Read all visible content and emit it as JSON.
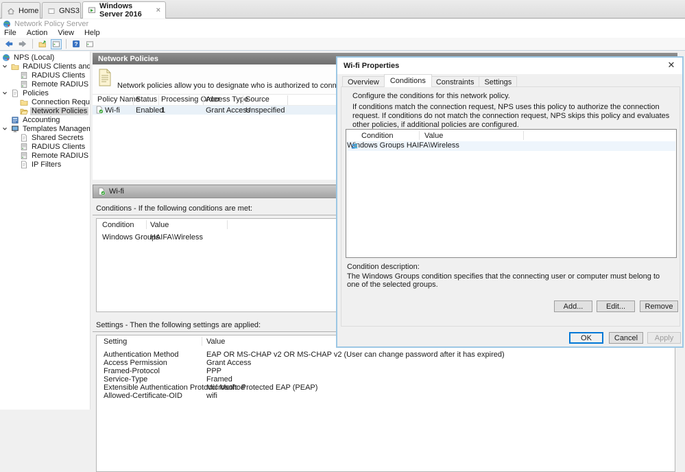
{
  "colors": {
    "accent": "#0078d7",
    "dialog_border": "#9cc7e4",
    "panel_header": "#6e6e6e",
    "selection_bg": "#d4d4d4",
    "row_highlight": "#e9f1f8"
  },
  "browser_tabs": [
    {
      "label": "Home"
    },
    {
      "label": "GNS3"
    },
    {
      "label": "Windows Server 2016"
    }
  ],
  "app": {
    "title": "Network Policy Server"
  },
  "menu": {
    "file": "File",
    "action": "Action",
    "view": "View",
    "help": "Help"
  },
  "tree": {
    "items": [
      {
        "label": "NPS (Local)"
      },
      {
        "label": "RADIUS Clients and Servers"
      },
      {
        "label": "RADIUS Clients"
      },
      {
        "label": "Remote RADIUS Server"
      },
      {
        "label": "Policies"
      },
      {
        "label": "Connection Request Po"
      },
      {
        "label": "Network Policies"
      },
      {
        "label": "Accounting"
      },
      {
        "label": "Templates Management"
      },
      {
        "label": "Shared Secrets"
      },
      {
        "label": "RADIUS Clients"
      },
      {
        "label": "Remote RADIUS Servers"
      },
      {
        "label": "IP Filters"
      }
    ]
  },
  "main": {
    "header": "Network Policies",
    "description": "Network policies allow you to designate who is authorized to connect to the network and the circ",
    "policy_table": {
      "columns": [
        "Policy Name",
        "Status",
        "Processing Order",
        "Access Type",
        "Source"
      ],
      "rows": [
        {
          "name": "Wi-fi",
          "status": "Enabled",
          "order": "1",
          "access": "Grant Access",
          "source": "Unspecified"
        }
      ]
    },
    "policy_section": {
      "title": "Wi-fi"
    },
    "conditions_header": "Conditions - If the following conditions are met:",
    "conditions_table": {
      "columns": [
        "Condition",
        "Value"
      ],
      "rows": [
        {
          "condition": "Windows Groups",
          "value": "HAIFA\\Wireless"
        }
      ]
    },
    "settings_header": "Settings - Then the following settings are applied:",
    "settings_table": {
      "columns": [
        "Setting",
        "Value"
      ],
      "rows": [
        {
          "setting": "Authentication Method",
          "value": "EAP OR MS-CHAP v2 OR MS-CHAP v2 (User can change password after it has expired)"
        },
        {
          "setting": "Access Permission",
          "value": "Grant Access"
        },
        {
          "setting": "Framed-Protocol",
          "value": "PPP"
        },
        {
          "setting": "Service-Type",
          "value": "Framed"
        },
        {
          "setting": "Extensible Authentication Protocol Method",
          "value": "Microsoft: Protected EAP (PEAP)"
        },
        {
          "setting": "Allowed-Certificate-OID",
          "value": "wifi"
        }
      ]
    }
  },
  "dialog": {
    "title": "Wi-fi Properties",
    "tabs": [
      {
        "label": "Overview"
      },
      {
        "label": "Conditions"
      },
      {
        "label": "Constraints"
      },
      {
        "label": "Settings"
      }
    ],
    "intro": "Configure the conditions for this network policy.",
    "body": "If conditions match the connection request, NPS uses this policy to authorize the connection request. If conditions do not match the connection request, NPS skips this policy and evaluates other policies, if additional policies are configured.",
    "table": {
      "columns": [
        "Condition",
        "Value"
      ],
      "rows": [
        {
          "condition": "Windows Groups",
          "value": "HAIFA\\Wireless"
        }
      ]
    },
    "description_label": "Condition description:",
    "description": "The Windows Groups condition specifies that the connecting user or computer must belong to one of the selected groups.",
    "buttons": {
      "add": "Add...",
      "edit": "Edit...",
      "remove": "Remove",
      "ok": "OK",
      "cancel": "Cancel",
      "apply": "Apply"
    }
  }
}
